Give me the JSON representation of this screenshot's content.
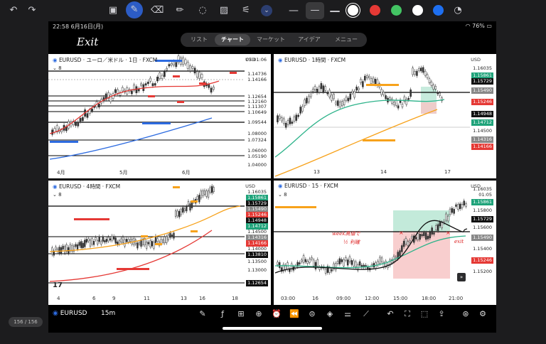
{
  "status": {
    "time": "22:58",
    "date": "6月16日(月)",
    "battery": "76%"
  },
  "nav": {
    "items": [
      "リスト",
      "チャート",
      "マーケット",
      "アイデア",
      "メニュー"
    ],
    "active": 1
  },
  "handwriting": {
    "title": "Exit"
  },
  "colors": {
    "black": "#000000",
    "white": "#ffffff",
    "red": "#e53935",
    "green": "#43c463",
    "blue": "#1e6ff0"
  },
  "panels": {
    "p1": {
      "title": "EURUSD · ユーロ／米ドル · 1日 · FXCM",
      "count": "8",
      "usd": "USD",
      "labels": [
        "07:01:06",
        "1.14736",
        "1.14166",
        "1.12654",
        "1.12160",
        "1.11307",
        "1.10649",
        "1.09544",
        "1.08000",
        "1.07324",
        "1.06000",
        "1.05190",
        "1.04000"
      ],
      "xticks": [
        "4月",
        "5月",
        "6月"
      ]
    },
    "p2": {
      "title": "EURUSD · 1時間 · FXCM",
      "usd": "USD",
      "labels": [
        "1.16035",
        "1.15861",
        "1.15729",
        "1.15490",
        "1.15246",
        "1.14948",
        "1.14712",
        "1.14500",
        "1.14316",
        "1.14166"
      ],
      "xticks": [
        "13",
        "14",
        "17"
      ]
    },
    "p3": {
      "title": "EURUSD · 4時間 · FXCM",
      "count": "8",
      "usd": "USD",
      "labels": [
        "1.16035",
        "1.15861",
        "1.15729",
        "1.15490",
        "1.15246",
        "1.14948",
        "1.14712",
        "1.14500",
        "1.14316",
        "1.14166",
        "1.14000",
        "1.13810",
        "1.13500",
        "1.13000",
        "1.12654"
      ],
      "xticks": [
        "4",
        "6",
        "9",
        "11",
        "13",
        "16",
        "18"
      ]
    },
    "p4": {
      "title": "EURUSD · 15 · FXCM",
      "count": "8",
      "usd": "USD",
      "labels": [
        "1.16035",
        "01:05",
        "1.15861",
        "1.15800",
        "1.15729",
        "1.15600",
        "1.15490",
        "1.15400",
        "1.15246",
        "1.15200"
      ],
      "xticks": [
        "03:00",
        "16",
        "09:00",
        "12:00",
        "15:00",
        "18:00",
        "21:00"
      ],
      "note1": "week高値で",
      "note2": "½ 利確",
      "note3": "exit"
    }
  },
  "bottom": {
    "symbol": "EURUSD",
    "interval": "15m"
  },
  "page": {
    "indicator": "156 / 156"
  }
}
